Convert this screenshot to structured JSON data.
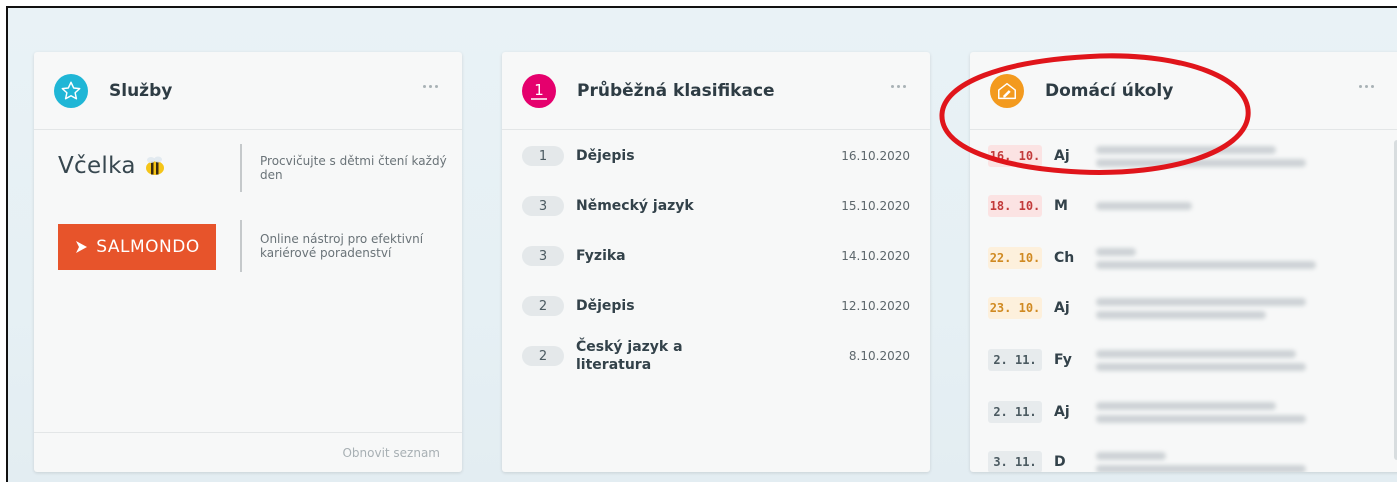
{
  "services": {
    "title": "Služby",
    "icon": "star-icon",
    "accent": "#1fb6d6",
    "items": [
      {
        "name": "Včelka",
        "description": "Procvičujte s dětmi čtení každý den"
      },
      {
        "name": "SALMONDO",
        "description": "Online nástroj pro efektivní kariérové poradenství"
      }
    ],
    "footer_link": "Obnovit seznam"
  },
  "grades": {
    "title": "Průběžná klasifikace",
    "icon": "grade-icon",
    "icon_digit": "1",
    "accent": "#e5006d",
    "rows": [
      {
        "grade": "1",
        "subject": "Dějepis",
        "date": "16.10.2020"
      },
      {
        "grade": "3",
        "subject": "Německý jazyk",
        "date": "15.10.2020"
      },
      {
        "grade": "3",
        "subject": "Fyzika",
        "date": "14.10.2020"
      },
      {
        "grade": "2",
        "subject": "Dějepis",
        "date": "12.10.2020"
      },
      {
        "grade": "2",
        "subject": "Český jazyk a literatura",
        "date": "8.10.2020"
      }
    ]
  },
  "homework": {
    "title": "Domácí úkoly",
    "icon": "homework-icon",
    "accent": "#f39a1e",
    "rows": [
      {
        "date": "16. 10.",
        "subject": "Aj",
        "status": "overdue"
      },
      {
        "date": "18. 10.",
        "subject": "M",
        "status": "overdue"
      },
      {
        "date": "22. 10.",
        "subject": "Ch",
        "status": "soon"
      },
      {
        "date": "23. 10.",
        "subject": "Aj",
        "status": "soon"
      },
      {
        "date": "2. 11.",
        "subject": "Fy",
        "status": "later"
      },
      {
        "date": "2. 11.",
        "subject": "Aj",
        "status": "later"
      },
      {
        "date": "3. 11.",
        "subject": "D",
        "status": "later"
      }
    ]
  },
  "colors": {
    "overdue_bg": "#fbe3e3",
    "overdue_fg": "#c23a3a",
    "soon_bg": "#fdf0dc",
    "soon_fg": "#d08a22",
    "later_bg": "#e7ebed",
    "later_fg": "#4b5a61",
    "annotation": "#e0151b"
  }
}
